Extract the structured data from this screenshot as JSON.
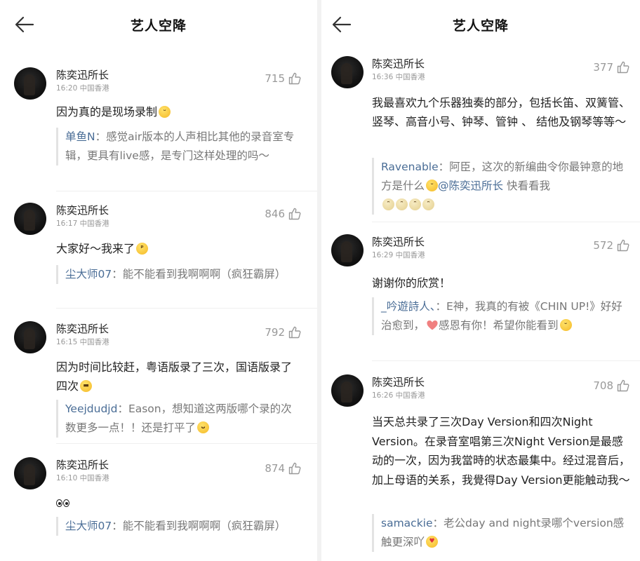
{
  "left": {
    "title": "艺人空降",
    "comments": [
      {
        "user": "陈奕迅所长",
        "meta": "16:20 中国香港",
        "likes": "715",
        "text": "因为真的是现场录制",
        "reply_user": "单鱼N",
        "reply_text": "：感觉air版本的人声相比其他的录音室专辑，更具有live感，是专门这样处理的吗～"
      },
      {
        "user": "陈奕迅所长",
        "meta": "16:17 中国香港",
        "likes": "846",
        "text": "大家好～我来了",
        "reply_user": "尘大师07",
        "reply_text": "：能不能看到我啊啊啊（疯狂霸屏）"
      },
      {
        "user": "陈奕迅所长",
        "meta": "16:15 中国香港",
        "likes": "792",
        "text": "因为时间比较赶，粤语版录了三次，国语版录了四次",
        "reply_user": "Yeejdudjd",
        "reply_text": "：Eason，想知道这两版哪个录的次数更多一点！！还是打平了"
      },
      {
        "user": "陈奕迅所长",
        "meta": "16:10 中国香港",
        "likes": "874",
        "text": "",
        "reply_user": "尘大师07",
        "reply_text": "：能不能看到我啊啊啊（疯狂霸屏）"
      }
    ]
  },
  "right": {
    "title": "艺人空降",
    "comments": [
      {
        "user": "陈奕迅所长",
        "meta": "16:36 中国香港",
        "likes": "377",
        "text": "我最喜欢九个乐器独奏的部分，包括长笛、双簧管、竖琴、高音小号、钟琴、管钟 、 结他及钢琴等等～",
        "reply_user": "Ravenable",
        "reply_text": "：阿臣，这次的新编曲令你最钟意的地方是什么",
        "reply_mention": "@陈奕迅所长",
        "reply_tail": " 快看看我"
      },
      {
        "user": "陈奕迅所长",
        "meta": "16:29 中国香港",
        "likes": "572",
        "text": "谢谢你的欣赏！",
        "reply_user": "_吟遊詩人、",
        "reply_text": "：E神，我真的有被《CHIN UP!》好好治愈到，",
        "reply_tail": "感恩有你！希望你能看到"
      },
      {
        "user": "陈奕迅所长",
        "meta": "16:26 中国香港",
        "likes": "708",
        "text": "当天总共录了三次Day Version和四次Night Version。在录音室唱第三次Night Version是最感动的一次，因为我當時的状态最集中。经过混音后，加上母语的关系，我覺得Day Version更能触动我～",
        "reply_user": "samackie",
        "reply_text": "：老公day and night录哪个version感触更深吖"
      }
    ]
  },
  "icons": {
    "back": "arrow-left-icon",
    "like": "thumbs-up-icon",
    "avatar": "user-avatar"
  },
  "colors": {
    "username_link": "#4a6d96",
    "meta": "#999999",
    "reply_text": "#777777",
    "heart": "#f08080"
  }
}
